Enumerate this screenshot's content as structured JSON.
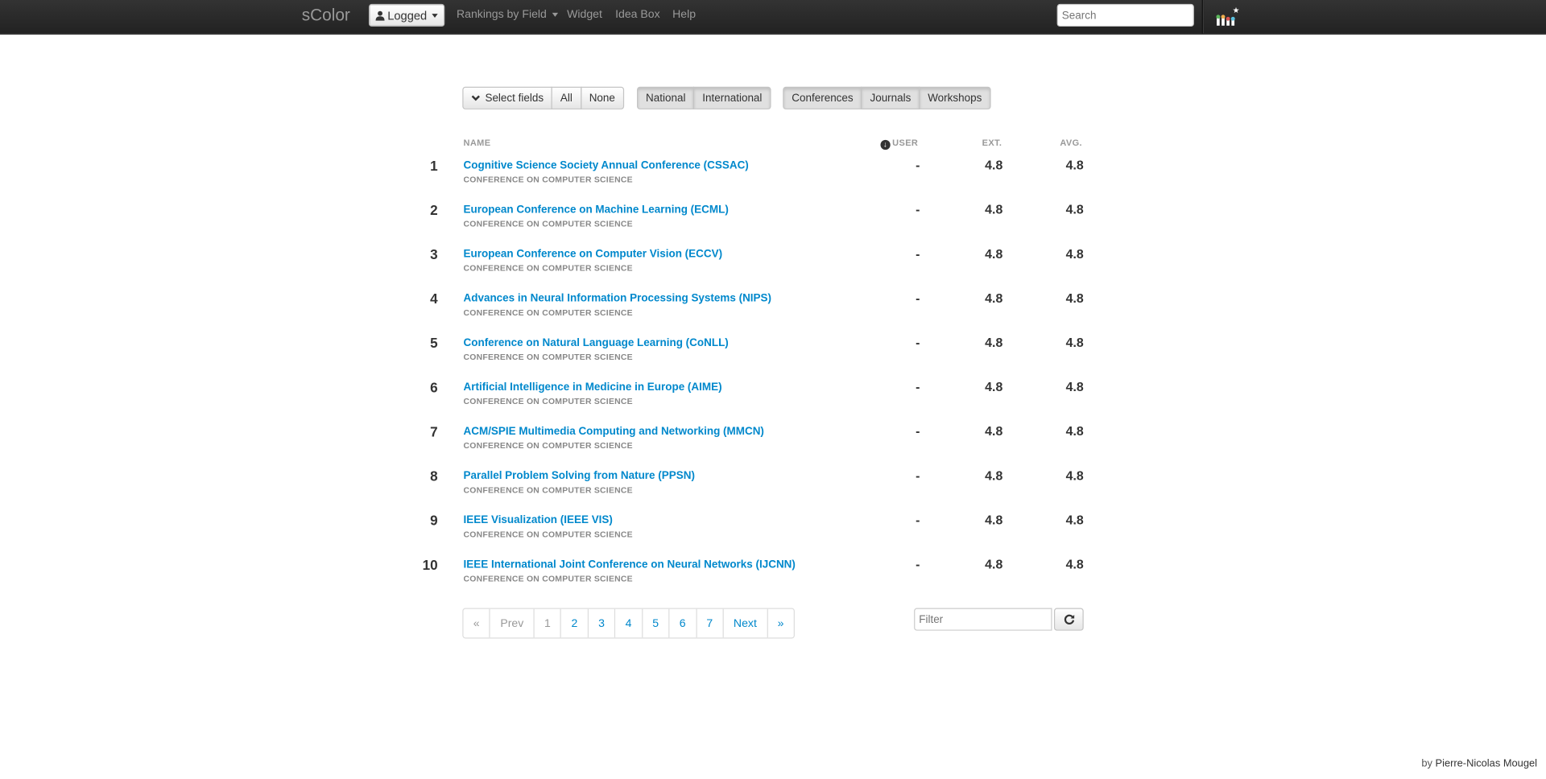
{
  "nav": {
    "brand": "sColor",
    "logged_label": "Logged",
    "rankings_label": "Rankings by Field",
    "widget_label": "Widget",
    "idea_box_label": "Idea Box",
    "help_label": "Help",
    "search_placeholder": "Search"
  },
  "filters": {
    "select_fields": "Select fields",
    "all": "All",
    "none": "None",
    "national": "National",
    "international": "International",
    "conferences": "Conferences",
    "journals": "Journals",
    "workshops": "Workshops"
  },
  "table": {
    "headers": {
      "name": "NAME",
      "user": "USER",
      "ext": "EXT.",
      "avg": "AVG."
    },
    "rows": [
      {
        "rank": "1",
        "title": "Cognitive Science Society Annual Conference (CSSAC)",
        "subtitle": "CONFERENCE ON COMPUTER SCIENCE",
        "user": "-",
        "ext": "4.8",
        "avg": "4.8"
      },
      {
        "rank": "2",
        "title": "European Conference on Machine Learning (ECML)",
        "subtitle": "CONFERENCE ON COMPUTER SCIENCE",
        "user": "-",
        "ext": "4.8",
        "avg": "4.8"
      },
      {
        "rank": "3",
        "title": "European Conference on Computer Vision (ECCV)",
        "subtitle": "CONFERENCE ON COMPUTER SCIENCE",
        "user": "-",
        "ext": "4.8",
        "avg": "4.8"
      },
      {
        "rank": "4",
        "title": "Advances in Neural Information Processing Systems (NIPS)",
        "subtitle": "CONFERENCE ON COMPUTER SCIENCE",
        "user": "-",
        "ext": "4.8",
        "avg": "4.8"
      },
      {
        "rank": "5",
        "title": "Conference on Natural Language Learning (CoNLL)",
        "subtitle": "CONFERENCE ON COMPUTER SCIENCE",
        "user": "-",
        "ext": "4.8",
        "avg": "4.8"
      },
      {
        "rank": "6",
        "title": "Artificial Intelligence in Medicine in Europe (AIME)",
        "subtitle": "CONFERENCE ON COMPUTER SCIENCE",
        "user": "-",
        "ext": "4.8",
        "avg": "4.8"
      },
      {
        "rank": "7",
        "title": "ACM/SPIE Multimedia Computing and Networking (MMCN)",
        "subtitle": "CONFERENCE ON COMPUTER SCIENCE",
        "user": "-",
        "ext": "4.8",
        "avg": "4.8"
      },
      {
        "rank": "8",
        "title": "Parallel Problem Solving from Nature (PPSN)",
        "subtitle": "CONFERENCE ON COMPUTER SCIENCE",
        "user": "-",
        "ext": "4.8",
        "avg": "4.8"
      },
      {
        "rank": "9",
        "title": "IEEE Visualization (IEEE VIS)",
        "subtitle": "CONFERENCE ON COMPUTER SCIENCE",
        "user": "-",
        "ext": "4.8",
        "avg": "4.8"
      },
      {
        "rank": "10",
        "title": "IEEE International Joint Conference on Neural Networks (IJCNN)",
        "subtitle": "CONFERENCE ON COMPUTER SCIENCE",
        "user": "-",
        "ext": "4.8",
        "avg": "4.8"
      }
    ]
  },
  "pagination": {
    "first": "«",
    "prev": "Prev",
    "pages": [
      "1",
      "2",
      "3",
      "4",
      "5",
      "6",
      "7"
    ],
    "next": "Next",
    "last": "»"
  },
  "filter_placeholder": "Filter",
  "footer": {
    "by": "by",
    "author": "Pierre-Nicolas Mougel"
  },
  "colors": {
    "link": "#0088cc",
    "navbar": "#222222",
    "muted": "#999999"
  }
}
